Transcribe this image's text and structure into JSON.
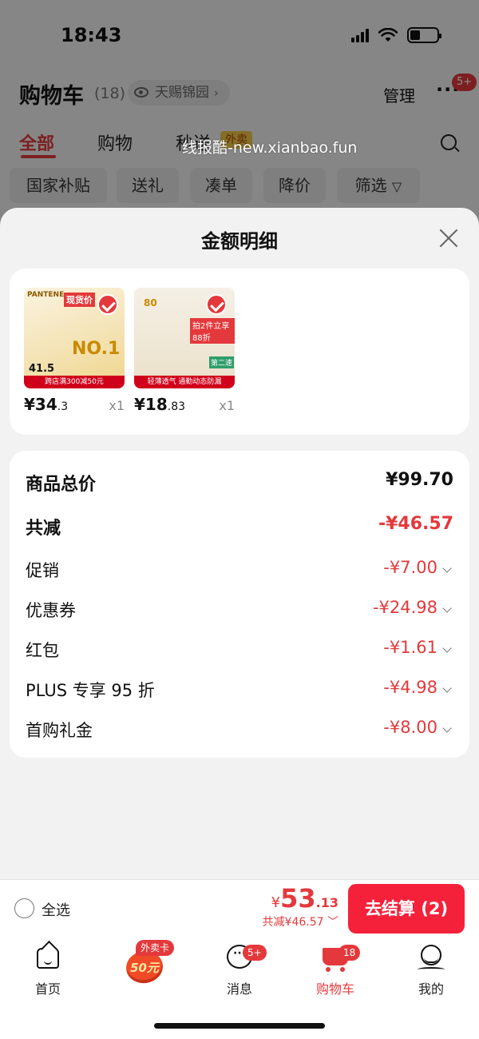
{
  "status_bar": {
    "time": "18:43"
  },
  "header": {
    "title": "购物车",
    "count": "(18)",
    "location": "天赐锦园",
    "manage": "管理",
    "more": "···",
    "more_badge": "5+"
  },
  "tabs": [
    {
      "label": "全部",
      "active": true
    },
    {
      "label": "购物",
      "active": false
    },
    {
      "label": "秒送",
      "active": false
    }
  ],
  "tab_tag": "外卖",
  "watermark": "线报酷-new.xianbao.fun",
  "filters": [
    "国家补贴",
    "送礼",
    "凑单",
    "降价",
    "筛选"
  ],
  "sheet": {
    "title": "金额明细",
    "products": [
      {
        "price_main": "¥34",
        "price_small": ".3",
        "qty": "x1",
        "thumb_brand": "PANTENE",
        "thumb_strip": "跨店满300减50元",
        "thumb_label": "现货价",
        "thumb_sub": "NO.1",
        "thumb_price": "41.5"
      },
      {
        "price_main": "¥18",
        "price_small": ".83",
        "qty": "x1",
        "thumb_brand": "",
        "thumb_strip": "轻薄透气 通勤动态防漏",
        "thumb_label": "拍2件立享88折",
        "thumb_sub": "第二速",
        "thumb_price": "80"
      }
    ],
    "rows": [
      {
        "label": "商品总价",
        "value": "¥99.70",
        "style": "bold",
        "red": false,
        "chevron": false
      },
      {
        "label": "共减",
        "value": "-¥46.57",
        "style": "bold",
        "red": true,
        "chevron": false
      },
      {
        "label": "促销",
        "value": "-¥7.00",
        "style": "normal",
        "red": true,
        "chevron": true
      },
      {
        "label": "优惠券",
        "value": "-¥24.98",
        "style": "normal",
        "red": true,
        "chevron": true
      },
      {
        "label": "红包",
        "value": "-¥1.61",
        "style": "normal",
        "red": true,
        "chevron": true
      },
      {
        "label": "PLUS 专享 95 折",
        "value": "-¥4.98",
        "style": "normal",
        "red": true,
        "chevron": true
      },
      {
        "label": "首购礼金",
        "value": "-¥8.00",
        "style": "normal",
        "red": true,
        "chevron": true
      }
    ]
  },
  "checkout": {
    "select_all": "全选",
    "currency": "¥",
    "total_int": "53",
    "total_dec": ".13",
    "saving": "共减¥46.57",
    "button": "去结算 (2)"
  },
  "tabbar": {
    "items": [
      {
        "label": "首页",
        "icon": "home-icon",
        "badge": ""
      },
      {
        "label": "",
        "icon": "takeaway-card-icon",
        "badge": "外卖卡",
        "promo": "50元"
      },
      {
        "label": "消息",
        "icon": "message-icon",
        "badge": "5+"
      },
      {
        "label": "购物车",
        "icon": "cart-icon",
        "badge": "18"
      },
      {
        "label": "我的",
        "icon": "profile-icon",
        "badge": ""
      }
    ]
  },
  "colors": {
    "accent": "#e4393c",
    "checkout_button": "#f5213a",
    "sheet_bg": "#f2f2f2",
    "card_bg": "#ffffff"
  }
}
